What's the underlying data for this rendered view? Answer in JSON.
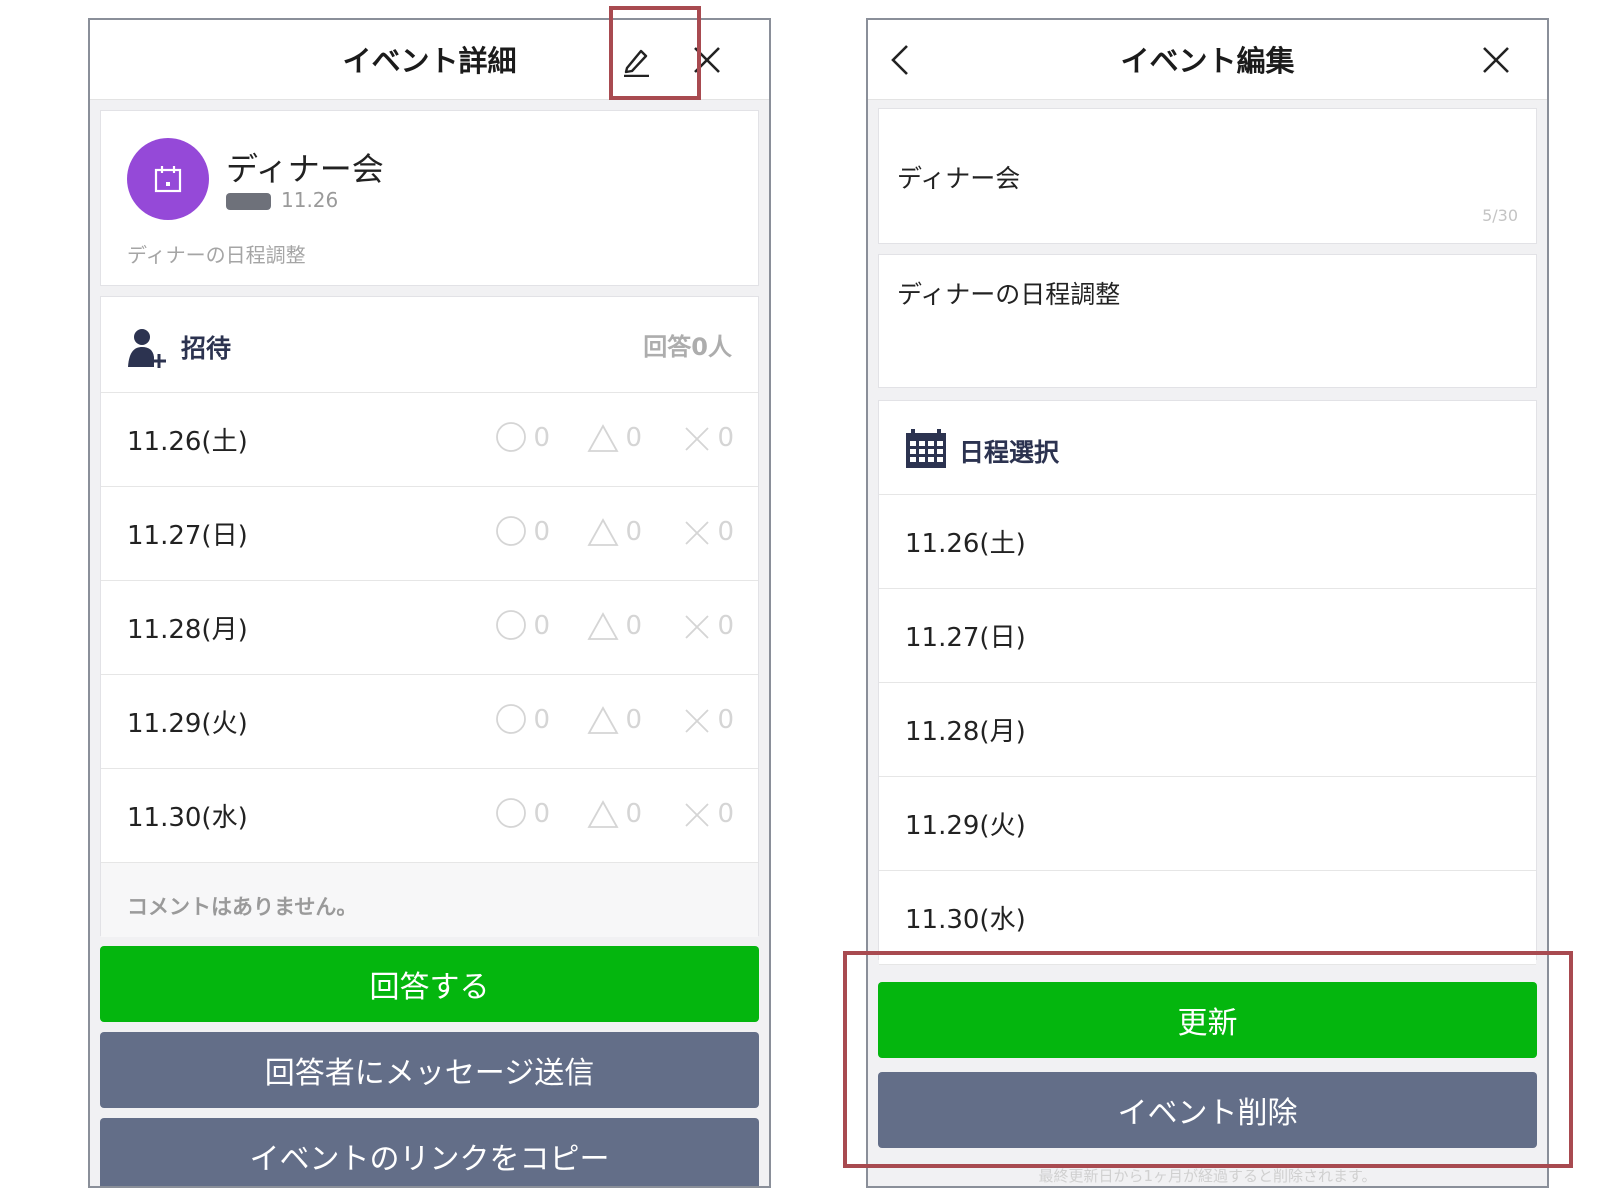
{
  "left_screen": {
    "header": {
      "title": "イベント詳細"
    },
    "event": {
      "title": "ディナー会",
      "date": "11.26",
      "description": "ディナーの日程調整"
    },
    "invite": {
      "label": "招待",
      "answer_count": "回答0人"
    },
    "dates": [
      {
        "label": "11.26(土)",
        "ok": "0",
        "maybe": "0",
        "ng": "0"
      },
      {
        "label": "11.27(日)",
        "ok": "0",
        "maybe": "0",
        "ng": "0"
      },
      {
        "label": "11.28(月)",
        "ok": "0",
        "maybe": "0",
        "ng": "0"
      },
      {
        "label": "11.29(火)",
        "ok": "0",
        "maybe": "0",
        "ng": "0"
      },
      {
        "label": "11.30(水)",
        "ok": "0",
        "maybe": "0",
        "ng": "0"
      }
    ],
    "comment": "コメントはありません。",
    "buttons": {
      "answer": "回答する",
      "message": "回答者にメッセージ送信",
      "copy_link": "イベントのリンクをコピー"
    }
  },
  "right_screen": {
    "header": {
      "title": "イベント編集"
    },
    "title_input": {
      "value": "ディナー会",
      "counter": "5/30"
    },
    "description_input": {
      "value": "ディナーの日程調整"
    },
    "schedule": {
      "label": "日程選択"
    },
    "dates": [
      "11.26(土)",
      "11.27(日)",
      "11.28(月)",
      "11.29(火)",
      "11.30(水)"
    ],
    "buttons": {
      "update": "更新",
      "delete": "イベント削除"
    },
    "notice": "最終更新日から1ヶ月が経過すると削除されます。"
  },
  "colors": {
    "avatar": "#9549d8",
    "primary_button": "#04b60e",
    "secondary_button": "#636e88",
    "highlight": "#a84a50",
    "section_label": "#2c3350"
  },
  "icons": {
    "edit": "pencil-icon",
    "close": "close-icon",
    "back": "chevron-left-icon",
    "avatar": "calendar-icon",
    "invite": "add-user-icon",
    "schedule": "calendar-grid-icon",
    "answer_ok": "circle-icon",
    "answer_maybe": "triangle-icon",
    "answer_ng": "cross-icon"
  }
}
